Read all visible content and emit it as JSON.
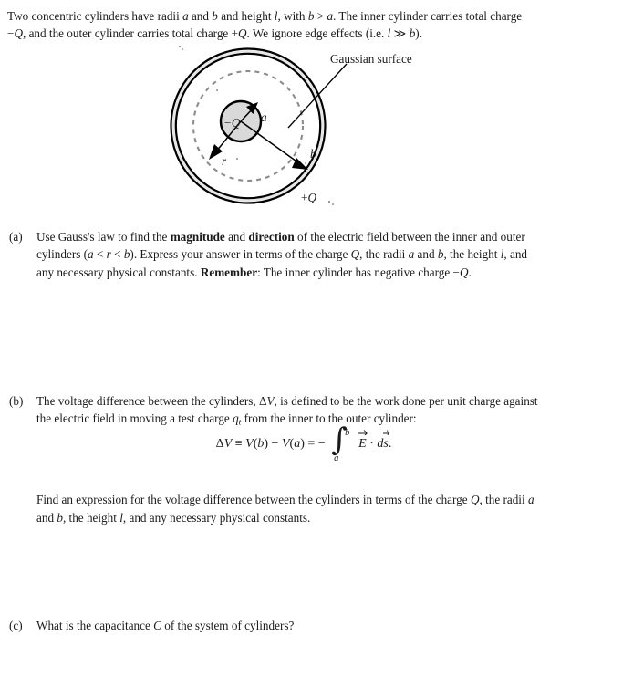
{
  "document": {
    "type": "physics-problem",
    "intro_lines": [
      "Two concentric cylinders have radii a and b and height l, with b > a. The inner cylinder carries total charge",
      "−Q, and the outer cylinder carries total charge +Q. We ignore edge effects (i.e. l ≫ b)."
    ]
  },
  "figure": {
    "name": "concentric-cylinders-cross-section",
    "gaussian_label": "Gaussian surface",
    "inner_charge_label": "−Q",
    "outer_charge_label": "+Q",
    "radius_labels": {
      "inner": "a",
      "gaussian": "r",
      "outer": "b"
    },
    "colors": {
      "inner_cylinder_fill": "#d9d9d9",
      "outer_ring_fill": "#e8e8e8",
      "stroke": "#000000",
      "gaussian_stroke": "#8c8c8c"
    }
  },
  "parts": {
    "a": {
      "marker": "(a)",
      "lines": [
        "Use Gauss's law to find the magnitude and direction of the electric field between the inner and outer",
        "cylinders (a < r < b). Express your answer in terms of the charge Q, the radii a and b, the height l, and",
        "any necessary physical constants. Remember: The inner cylinder has negative charge −Q."
      ]
    },
    "b": {
      "marker": "(b)",
      "lines": [
        "The voltage difference between the cylinders, ΔV, is defined to be the work done per unit charge against",
        "the electric field in moving a test charge qt from the inner to the outer cylinder:"
      ],
      "equation": {
        "lhs": "ΔV ≡ V(b) − V(a) = −",
        "integral_lower": "a",
        "integral_upper": "b",
        "integrand": "E · ds.",
        "plain": "ΔV ≡ V(b) − V(a) = − ∫ₐᵇ E⃗ · ds⃗."
      },
      "lines_after": [
        "Find an expression for the voltage difference between the cylinders in terms of the charge Q, the radii a",
        "and b, the height l, and any necessary physical constants."
      ]
    },
    "c": {
      "marker": "(c)",
      "lines": [
        "What is the capacitance C of the system of cylinders?"
      ]
    }
  }
}
